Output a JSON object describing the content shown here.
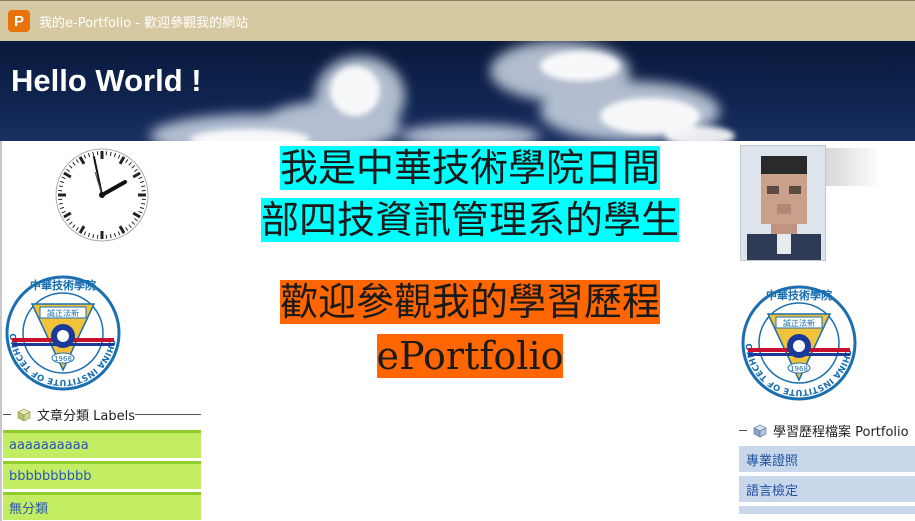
{
  "window": {
    "title": "我的e-Portfolio - 歡迎參觀我的網站",
    "icon_letter": "P",
    "icon_color": "#e8720c"
  },
  "banner": {
    "title": "Hello World !"
  },
  "headline": {
    "line1": "我是中華技術學院日間",
    "line2": "部四技資訊管理系的學生",
    "line1_highlight": "#00ffff",
    "welcome_line1": "歡迎參觀我的學習歷程",
    "welcome_line2": "ePortfolio",
    "welcome_highlight": "#ff6600"
  },
  "logo": {
    "top_text": "中華技術學院",
    "motto": "誠正法新",
    "year": "1968",
    "ring_text": "CHINA INSTITUTE OF TECHNOLOGY"
  },
  "labels_section": {
    "title": "文章分類 Labels",
    "items": [
      "aaaaaaaaaa",
      "bbbbbbbbbb",
      "無分類"
    ]
  },
  "portfolio_section": {
    "title": "學習歷程檔案 Portfolio",
    "items": [
      "專業證照",
      "語言檢定"
    ]
  },
  "colors": {
    "titlebar": "#d6c8a0",
    "banner": "#0f2450",
    "label_item": "#c2ec62",
    "portfolio_item": "#c8d8ea",
    "link": "#2a56b8"
  }
}
